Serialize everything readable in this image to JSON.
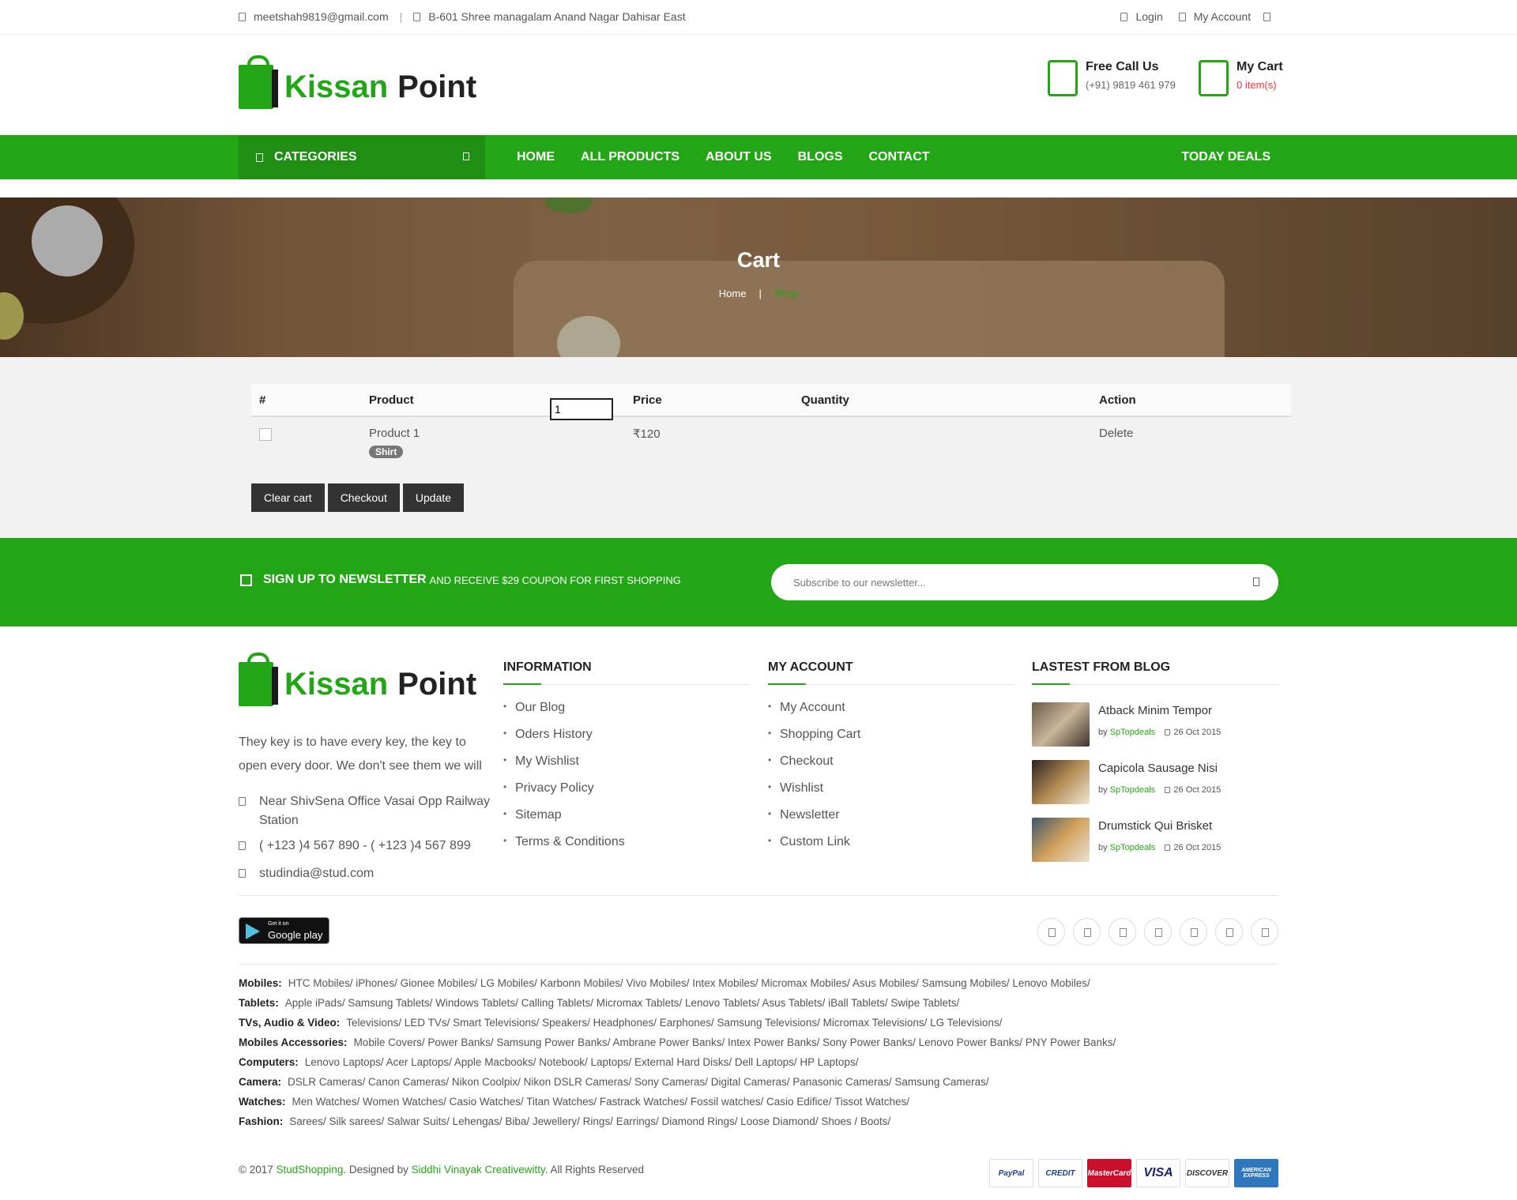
{
  "topbar": {
    "email": "meetshah9819@gmail.com",
    "address": "B-601 Shree managalam Anand Nagar Dahisar East",
    "login": "Login",
    "my_account": "My Account"
  },
  "brand": {
    "word1": "Kissan",
    "word2": "Point"
  },
  "header": {
    "call_title": "Free Call Us",
    "call_number": "(+91) 9819 461 979",
    "cart_title": "My Cart",
    "cart_count": "0 item(s)"
  },
  "nav": {
    "categories": "CATEGORIES",
    "items": [
      "HOME",
      "ALL PRODUCTS",
      "ABOUT US",
      "BLOGS",
      "CONTACT"
    ],
    "deals": "TODAY DEALS"
  },
  "hero": {
    "title": "Cart",
    "crumb_home": "Home",
    "crumb_sep": "|",
    "crumb_current": "Shop"
  },
  "cart": {
    "headers": [
      "#",
      "Product",
      "Price",
      "Quantity",
      "Action"
    ],
    "row": {
      "product": "Product 1",
      "tag": "Shirt",
      "price": "₹120",
      "qty": "1",
      "action": "Delete"
    },
    "buttons": {
      "clear": "Clear cart",
      "checkout": "Checkout",
      "update": "Update"
    }
  },
  "newsletter": {
    "bold": "SIGN UP TO NEWSLETTER",
    "rest": "AND RECEIVE $29 COUPON FOR FIRST SHOPPING",
    "placeholder": "Subscribe to our newsletter..."
  },
  "footer": {
    "about": "They key is to have every key, the key to open every door. We don't see them we will",
    "address": "Near ShivSena Office Vasai Opp Railway Station",
    "phone": "( +123 )4 567 890 - ( +123 )4 567 899",
    "email": "studindia@stud.com",
    "info_title": "INFORMATION",
    "info_items": [
      "Our Blog",
      "Oders History",
      "My Wishlist",
      "Privacy Policy",
      "Sitemap",
      "Terms & Conditions"
    ],
    "account_title": "MY ACCOUNT",
    "account_items": [
      "My Account",
      "Shopping Cart",
      "Checkout",
      "Wishlist",
      "Newsletter",
      "Custom Link"
    ],
    "blog_title": "LASTEST FROM BLOG",
    "blog": [
      {
        "title": "Atback Minim Tempor",
        "by": "by",
        "author": "SpTopdeals",
        "date": "26 Oct 2015"
      },
      {
        "title": "Capicola Sausage Nisi",
        "by": "by",
        "author": "SpTopdeals",
        "date": "26 Oct 2015"
      },
      {
        "title": "Drumstick Qui Brisket",
        "by": "by",
        "author": "SpTopdeals",
        "date": "26 Oct 2015"
      }
    ],
    "gplay_small": "Get it on",
    "gplay_big": "Google play"
  },
  "links": [
    {
      "label": "Mobiles:",
      "text": "HTC Mobiles/ iPhones/ Gionee Mobiles/ LG Mobiles/ Karbonn Mobiles/ Vivo Mobiles/ Intex Mobiles/ Micromax Mobiles/ Asus Mobiles/ Samsung Mobiles/ Lenovo Mobiles/"
    },
    {
      "label": "Tablets:",
      "text": "Apple iPads/ Samsung Tablets/ Windows Tablets/ Calling Tablets/ Micromax Tablets/ Lenovo Tablets/ Asus Tablets/ iBall Tablets/ Swipe Tablets/"
    },
    {
      "label": "TVs, Audio & Video:",
      "text": "Televisions/ LED TVs/ Smart Televisions/ Speakers/ Headphones/ Earphones/ Samsung Televisions/ Micromax Televisions/ LG Televisions/"
    },
    {
      "label": "Mobiles Accessories:",
      "text": "Mobile Covers/ Power Banks/ Samsung Power Banks/ Ambrane Power Banks/ Intex Power Banks/ Sony Power Banks/ Lenovo Power Banks/ PNY Power Banks/"
    },
    {
      "label": "Computers:",
      "text": "Lenovo Laptops/ Acer Laptops/ Apple Macbooks/ Notebook/ Laptops/ External Hard Disks/ Dell Laptops/ HP Laptops/"
    },
    {
      "label": "Camera:",
      "text": "DSLR Cameras/ Canon Cameras/ Nikon Coolpix/ Nikon DSLR Cameras/ Sony Cameras/ Digital Cameras/ Panasonic Cameras/ Samsung Cameras/"
    },
    {
      "label": "Watches:",
      "text": "Men Watches/ Women Watches/ Casio Watches/ Titan Watches/ Fastrack Watches/ Fossil watches/ Casio Edifice/ Tissot Watches/"
    },
    {
      "label": "Fashion:",
      "text": "Sarees/ Silk sarees/ Salwar Suits/ Lehengas/ Biba/ Jewellery/ Rings/ Earrings/ Diamond Rings/ Loose Diamond/ Shoes / Boots/"
    }
  ],
  "copyright": {
    "pre": "© 2017",
    "site": "StudShopping",
    "mid": ". Designed by",
    "designer": "Siddhi Vinayak Creativewitty",
    "post": ". All Rights Reserved"
  },
  "payments": [
    "PayPal",
    "CREDIT",
    "MasterCard",
    "VISA",
    "DISCOVER",
    "AMERICAN EXPRESS"
  ],
  "colors": {
    "brand_green": "#23a615",
    "dark_green": "#1e8f12",
    "button_dark": "#333333"
  }
}
